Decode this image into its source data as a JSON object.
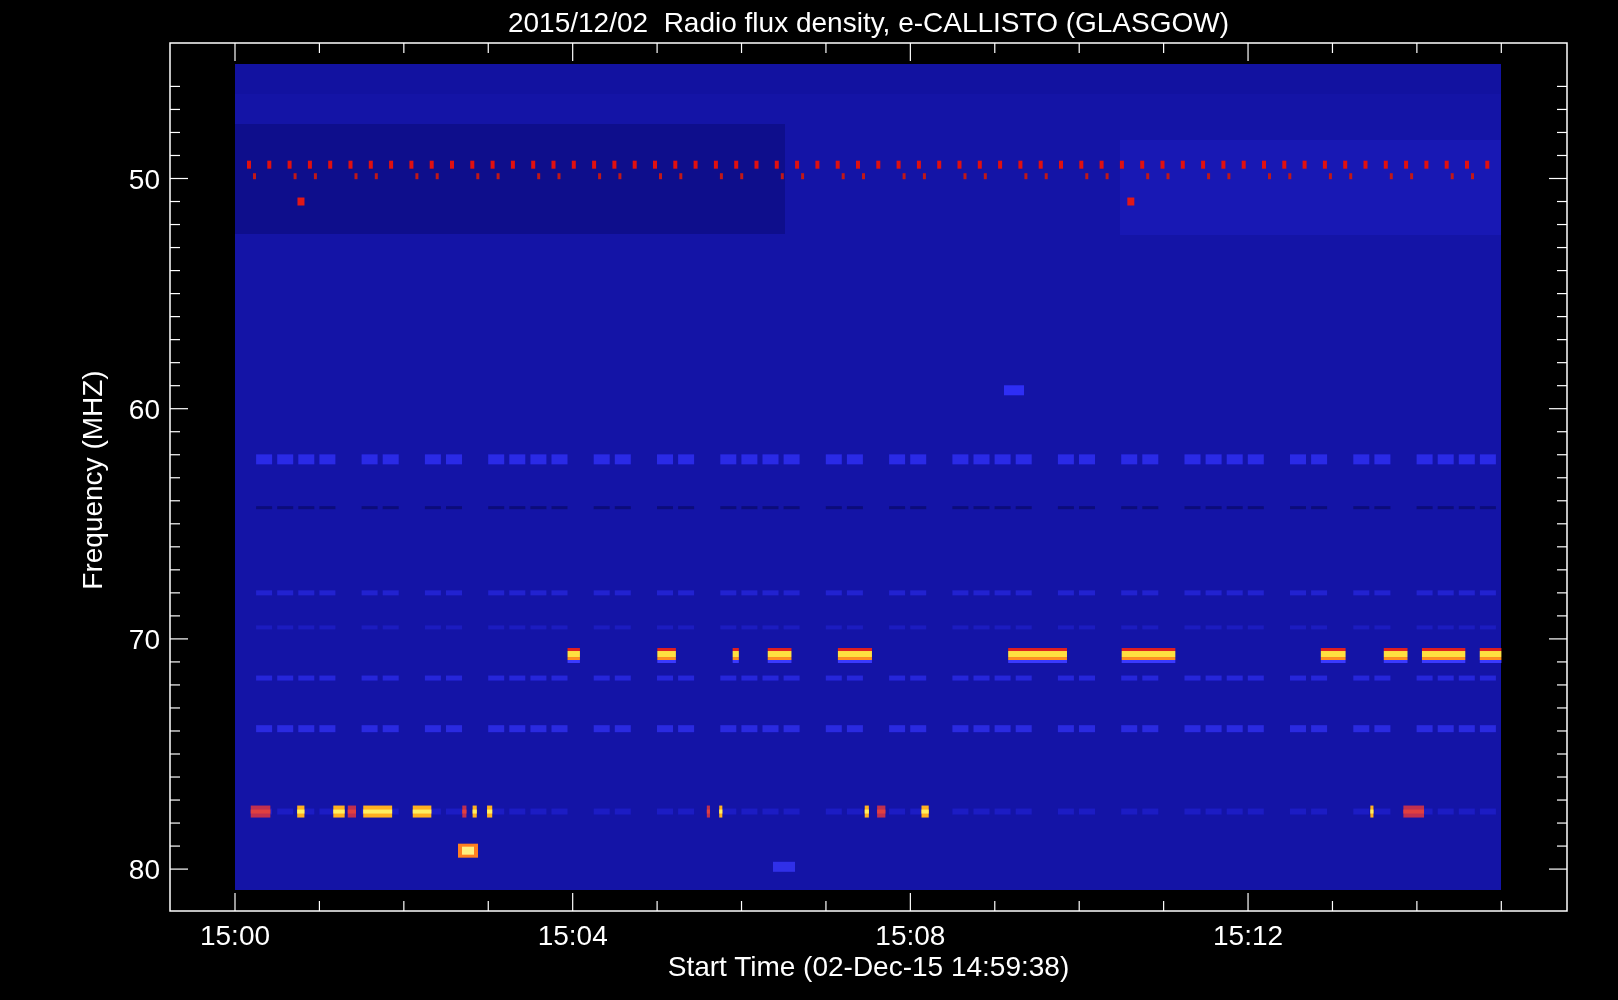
{
  "title": "2015/12/02  Radio flux density, e-CALLISTO (GLASGOW)",
  "y_axis": {
    "label": "Frequency (MHZ)",
    "ticks": [
      "50",
      "60",
      "70",
      "80"
    ]
  },
  "x_axis": {
    "label": "Start Time (02-Dec-15 14:59:38)",
    "ticks": [
      "15:00",
      "15:04",
      "15:08",
      "15:12"
    ]
  }
}
